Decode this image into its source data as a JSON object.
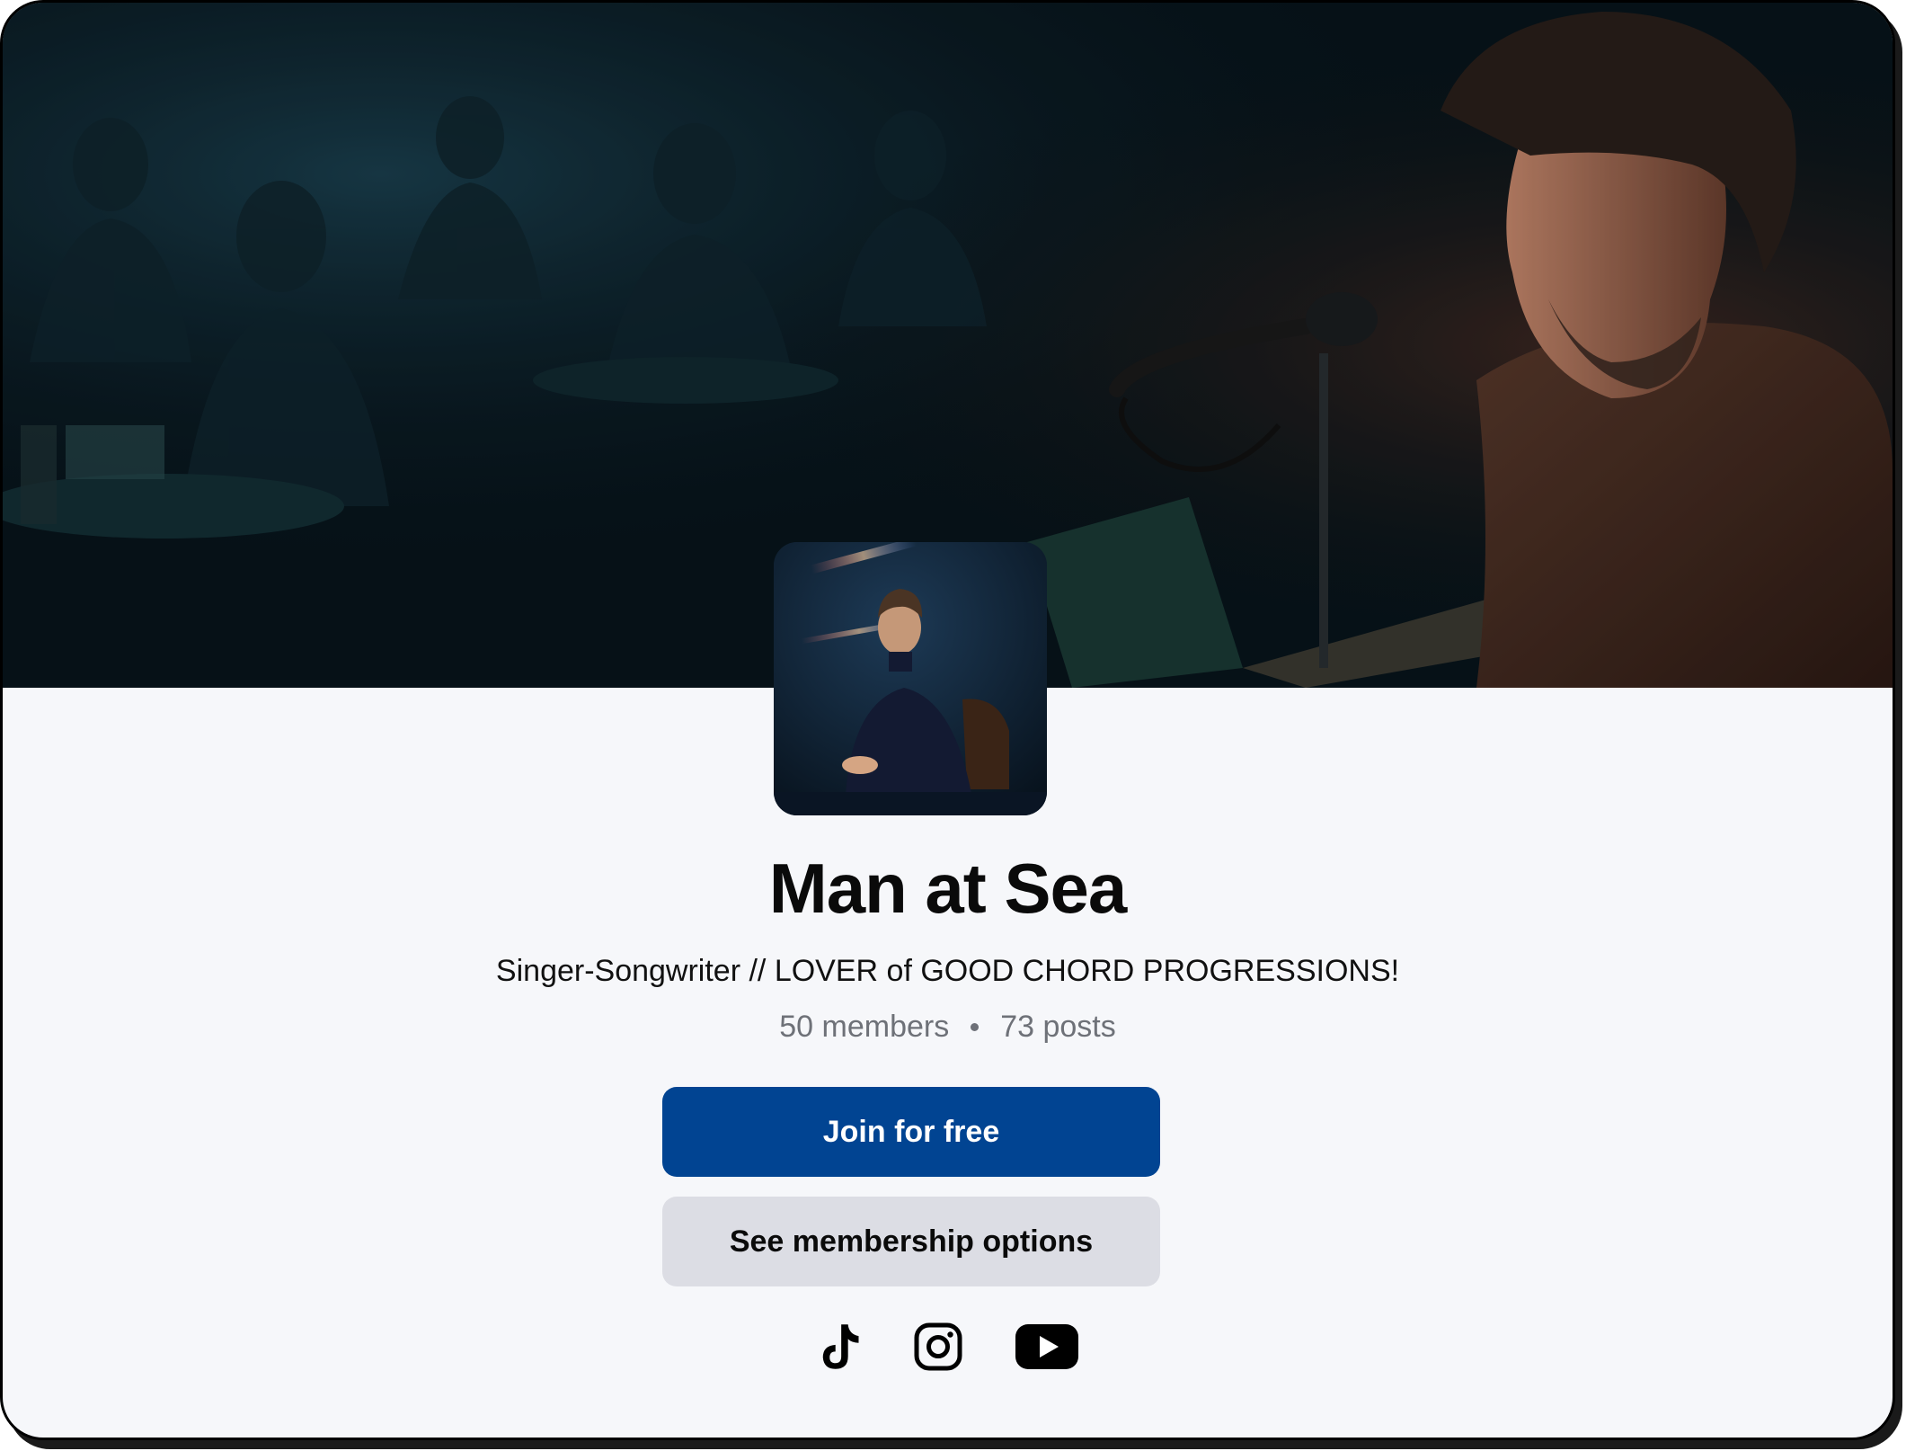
{
  "profile": {
    "name": "Man at Sea",
    "tagline": "Singer-Songwriter // LOVER of GOOD CHORD PROGRESSIONS!",
    "members": "50 members",
    "posts": "73 posts"
  },
  "actions": {
    "join_label": "Join for free",
    "membership_label": "See membership options"
  },
  "socials": [
    {
      "icon": "tiktok-icon"
    },
    {
      "icon": "instagram-icon"
    },
    {
      "icon": "youtube-icon"
    }
  ],
  "colors": {
    "primary": "#014492",
    "secondary": "#dcdde4",
    "page_background": "#f6f7fa",
    "muted_text": "#6e7178"
  }
}
